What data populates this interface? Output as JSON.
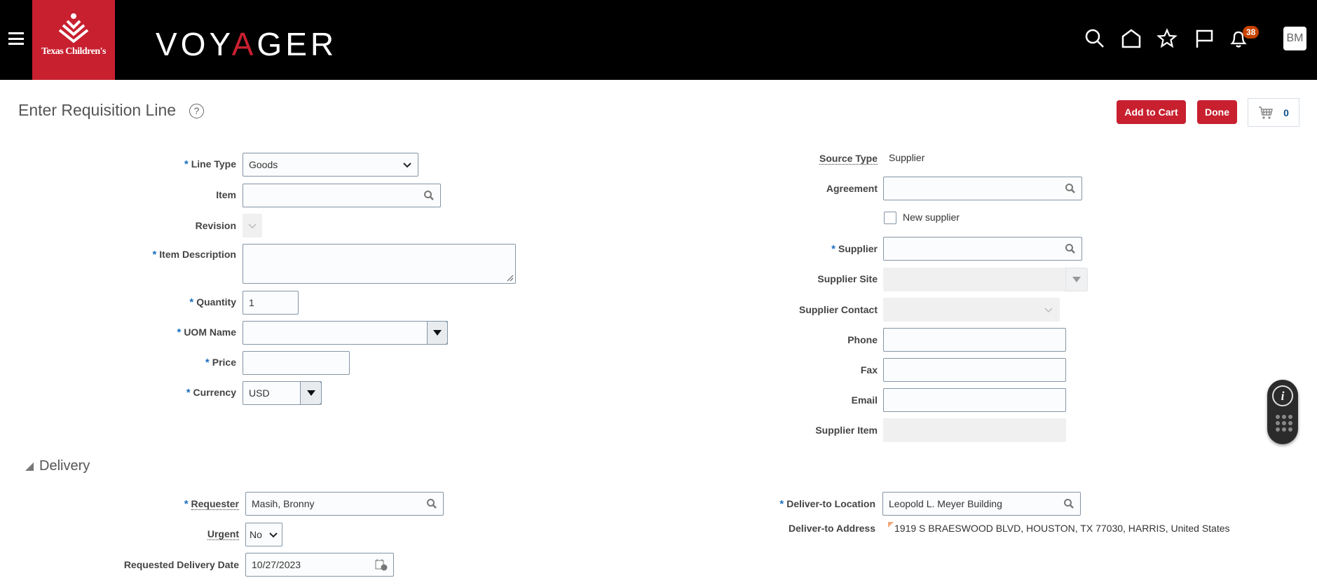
{
  "header": {
    "logo_text": "Texas Children's",
    "app_name_pre": "VOY",
    "app_name_mark": "A",
    "app_name_post": "GER",
    "notification_count": "38",
    "avatar_initials": "BM"
  },
  "page": {
    "title": "Enter Requisition Line",
    "help": "?",
    "add_to_cart": "Add to Cart",
    "done": "Done",
    "cart_count": "0"
  },
  "left": {
    "line_type": {
      "label": "Line Type",
      "value": "Goods"
    },
    "item": {
      "label": "Item",
      "value": ""
    },
    "revision": {
      "label": "Revision"
    },
    "item_description": {
      "label": "Item Description",
      "value": ""
    },
    "quantity": {
      "label": "Quantity",
      "value": "1"
    },
    "uom": {
      "label": "UOM Name",
      "value": ""
    },
    "price": {
      "label": "Price",
      "value": ""
    },
    "currency": {
      "label": "Currency",
      "value": "USD"
    }
  },
  "right": {
    "source_type": {
      "label": "Source Type",
      "value": "Supplier"
    },
    "agreement": {
      "label": "Agreement"
    },
    "new_supplier": {
      "label": "New supplier",
      "checked": false
    },
    "supplier": {
      "label": "Supplier"
    },
    "supplier_site": {
      "label": "Supplier Site"
    },
    "supplier_contact": {
      "label": "Supplier Contact"
    },
    "phone": {
      "label": "Phone"
    },
    "fax": {
      "label": "Fax"
    },
    "email": {
      "label": "Email"
    },
    "supplier_item": {
      "label": "Supplier Item"
    }
  },
  "delivery": {
    "title": "Delivery",
    "requester": {
      "label": "Requester",
      "value": "Masih, Bronny"
    },
    "urgent": {
      "label": "Urgent",
      "value": "No"
    },
    "requested_date": {
      "label": "Requested Delivery Date",
      "value": "10/27/2023"
    },
    "deliver_to_location": {
      "label": "Deliver-to Location",
      "value": "Leopold L. Meyer Building"
    },
    "deliver_to_address": {
      "label": "Deliver-to Address",
      "value": "1919 S BRAESWOOD BLVD, HOUSTON, TX 77030, HARRIS, United States"
    }
  },
  "colors": {
    "brand": "#c8202f",
    "header": "#000000",
    "badge": "#c74200",
    "required": "#1a6fbf"
  }
}
